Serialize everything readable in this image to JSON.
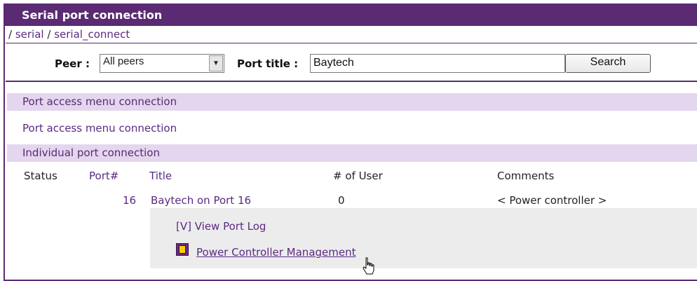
{
  "header": {
    "title": "Serial port connection"
  },
  "breadcrumb": {
    "sep1": "/",
    "item1": "serial",
    "sep2": "/",
    "item2": "serial_connect"
  },
  "search": {
    "peer_label": "Peer :",
    "peer_value": "All peers",
    "port_title_label": "Port title :",
    "port_title_value": "Baytech",
    "button_label": "Search"
  },
  "sections": {
    "port_access_header": "Port access menu connection",
    "port_access_link": "Port access menu connection",
    "individual_header": "Individual port connection"
  },
  "table": {
    "headers": {
      "status": "Status",
      "port": "Port#",
      "title": "Title",
      "users": "# of User",
      "comments": "Comments"
    },
    "rows": [
      {
        "status": "",
        "port": "16",
        "title": "Baytech on Port 16",
        "users": "0",
        "comments": "< Power controller >"
      }
    ]
  },
  "actions": {
    "view_log": "[V] View Port Log",
    "power_mgmt": "Power Controller Management"
  },
  "icons": {
    "power_mgmt": "power-controller-icon",
    "cursor": "hand-pointer-icon",
    "dropdown": "chevron-down-icon"
  },
  "colors": {
    "accent": "#5a2a72",
    "section_bg": "#e4d6ee",
    "link": "#5a2a82"
  }
}
